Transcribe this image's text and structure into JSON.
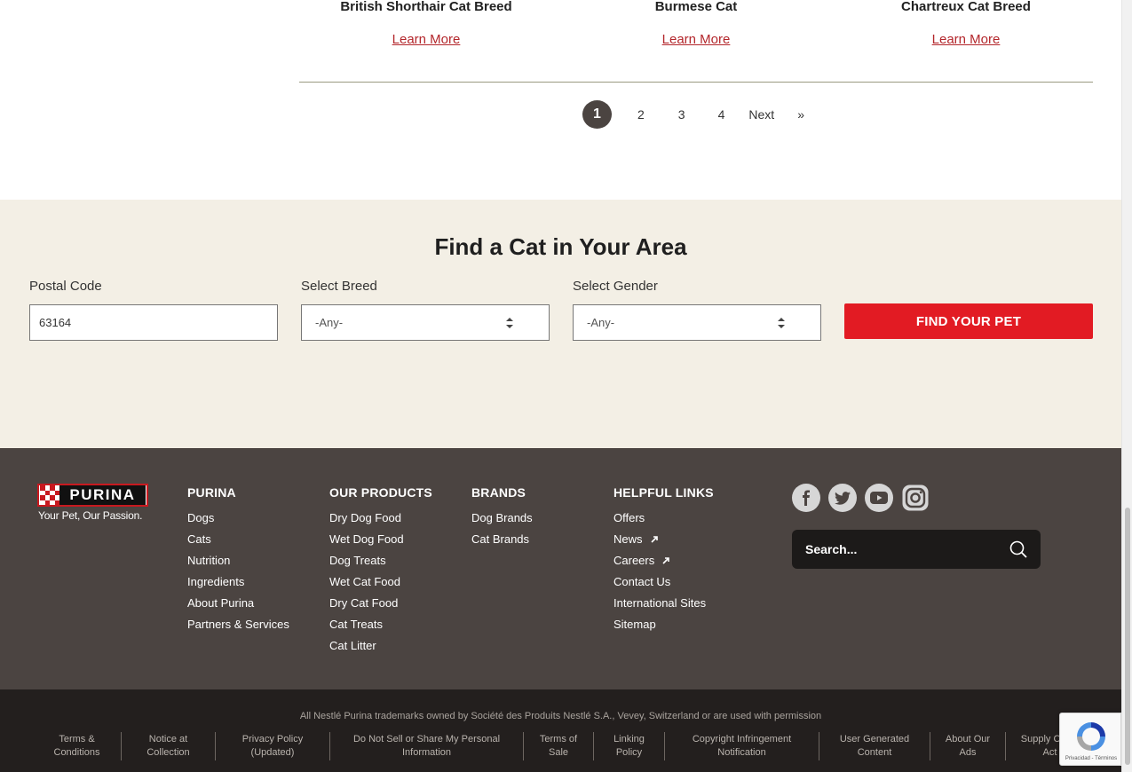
{
  "results": {
    "cards": [
      {
        "title": "British Shorthair Cat Breed",
        "link": "Learn More"
      },
      {
        "title": "Burmese Cat",
        "link": "Learn More"
      },
      {
        "title": "Chartreux Cat Breed",
        "link": "Learn More"
      }
    ],
    "pager": {
      "current": "1",
      "pages": [
        "2",
        "3",
        "4"
      ],
      "next": "Next",
      "last": "»"
    }
  },
  "finder": {
    "title": "Find a Cat in Your Area",
    "postal_label": "Postal Code",
    "postal_value": "63164",
    "breed_label": "Select Breed",
    "breed_value": "-Any-",
    "gender_label": "Select Gender",
    "gender_value": "-Any-",
    "button": "FIND YOUR PET"
  },
  "footer": {
    "logo_word": "PURINA",
    "tagline": "Your Pet, Our Passion.",
    "columns": [
      {
        "head": "PURINA",
        "links": [
          "Dogs",
          "Cats",
          "Nutrition",
          "Ingredients",
          "About Purina",
          "Partners & Services"
        ]
      },
      {
        "head": "OUR PRODUCTS",
        "links": [
          "Dry Dog Food",
          "Wet Dog Food",
          "Dog Treats",
          "Wet Cat Food",
          "Dry Cat Food",
          "Cat Treats",
          "Cat Litter"
        ]
      },
      {
        "head": "BRANDS",
        "links": [
          "Dog Brands",
          "Cat Brands"
        ]
      },
      {
        "head": "HELPFUL LINKS",
        "links": [
          "Offers",
          "News",
          "Careers",
          "Contact Us",
          "International Sites",
          "Sitemap"
        ]
      }
    ],
    "search_placeholder": "Search...",
    "social": [
      "facebook-icon",
      "twitter-icon",
      "youtube-icon",
      "instagram-icon"
    ]
  },
  "legal": {
    "trademark": "All Nestlé Purina trademarks owned by Société des Produits Nestlé S.A., Vevey, Switzerland or are used with permission",
    "links": [
      "Terms & Conditions",
      "Notice at Collection",
      "Privacy Policy (Updated)",
      "Do Not Sell or Share My Personal Information",
      "Terms of Sale",
      "Linking Policy",
      "Copyright Infringement Notification",
      "User Generated Content",
      "About Our Ads",
      "Supply Chain Act"
    ]
  },
  "recaptcha": {
    "text": "Privacidad - Términos"
  },
  "colors": {
    "accent": "#e21b23",
    "footer_bg": "#4b4441",
    "legal_bg": "#231f1e",
    "finder_bg": "#f3efe5",
    "link": "#b3262b"
  }
}
